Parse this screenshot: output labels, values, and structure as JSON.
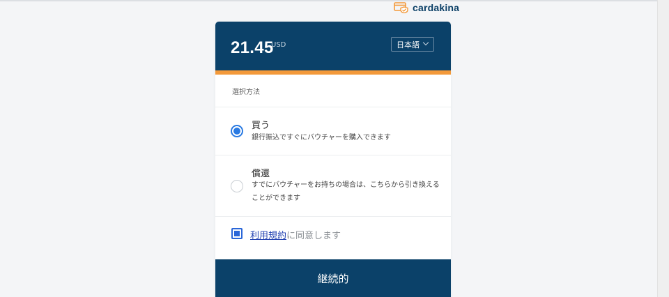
{
  "brand": {
    "name": "cardakina",
    "icon": "card-shield-icon",
    "color": "#0b3f66",
    "icon_color": "#f3993a"
  },
  "header": {
    "price": "21.45",
    "currency": "USD",
    "language": "日本語",
    "bg_color": "#0b4169",
    "accent_color": "#f3993a"
  },
  "selection": {
    "label": "選択方法"
  },
  "options": [
    {
      "title": "買う",
      "description": "銀行振込ですぐにバウチャーを購入できます",
      "selected": true
    },
    {
      "title": "償還",
      "description": "すでにバウチャーをお持ちの場合は、こちらから引き換えることができます",
      "selected": false
    }
  ],
  "terms": {
    "link_text": "利用規約",
    "text": "に同意します",
    "checked": true
  },
  "continue_button": {
    "label": "継続的"
  }
}
